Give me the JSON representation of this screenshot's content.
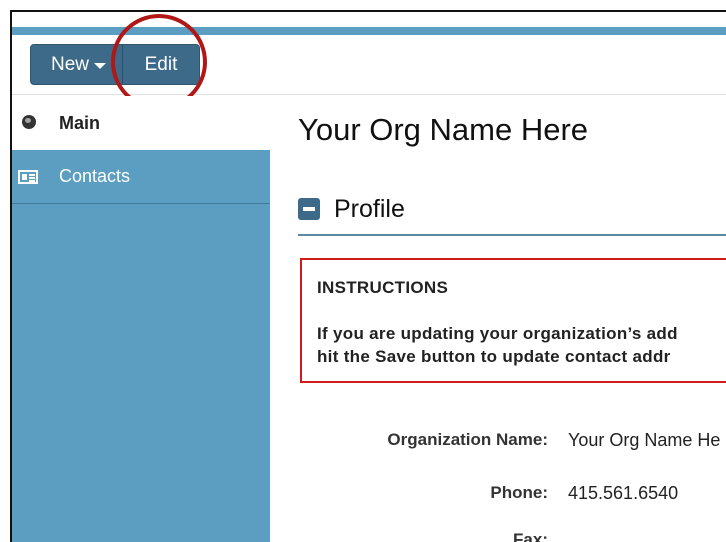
{
  "toolbar": {
    "new_label": "New",
    "edit_label": "Edit"
  },
  "sidebar": {
    "items": [
      {
        "label": "Main",
        "icon": "globe-icon",
        "active": true
      },
      {
        "label": "Contacts",
        "icon": "contact-card-icon",
        "active": false
      }
    ]
  },
  "main": {
    "org_title": "Your Org Name Here",
    "section_title": "Profile",
    "instructions": {
      "title": "INSTRUCTIONS",
      "line1": "If you are updating your organization’s add",
      "line2": "hit the Save button to update contact addr"
    },
    "fields": [
      {
        "label": "Organization Name:",
        "value": "Your Org Name He"
      },
      {
        "label": "Phone:",
        "value": "415.561.6540"
      },
      {
        "label": "Fax:",
        "value": ""
      }
    ]
  },
  "colors": {
    "accent": "#5b9ec1",
    "button": "#3d6a88",
    "highlight_circle": "#b01818",
    "instructions_border": "#d11b1b"
  }
}
